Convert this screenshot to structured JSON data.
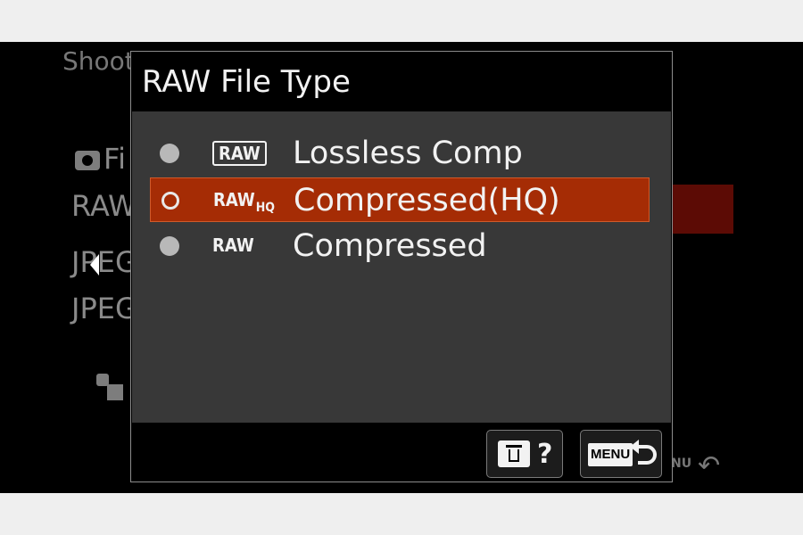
{
  "background_menu": {
    "tabs_partial": "Shooti",
    "items_partial": [
      "Fi",
      "RAW",
      "JPEG",
      "JPEG"
    ]
  },
  "dialog": {
    "title": "RAW File Type",
    "options": [
      {
        "format_badge": "RAW",
        "badge_sub": "",
        "label": "Lossless Comp",
        "selected": false
      },
      {
        "format_badge": "RAW",
        "badge_sub": "HQ",
        "label": "Compressed(HQ)",
        "selected": true
      },
      {
        "format_badge": "RAW",
        "badge_sub": "",
        "label": "Compressed",
        "selected": false
      }
    ],
    "footer": {
      "help_label": "?",
      "menu_label": "MENU"
    }
  },
  "colors": {
    "selected_highlight": "#a52c05",
    "dialog_body": "#383838"
  },
  "icons": [
    "trash-icon",
    "help-icon",
    "menu-icon",
    "back-arrow-icon",
    "camera-icon",
    "left-arrow-icon"
  ]
}
